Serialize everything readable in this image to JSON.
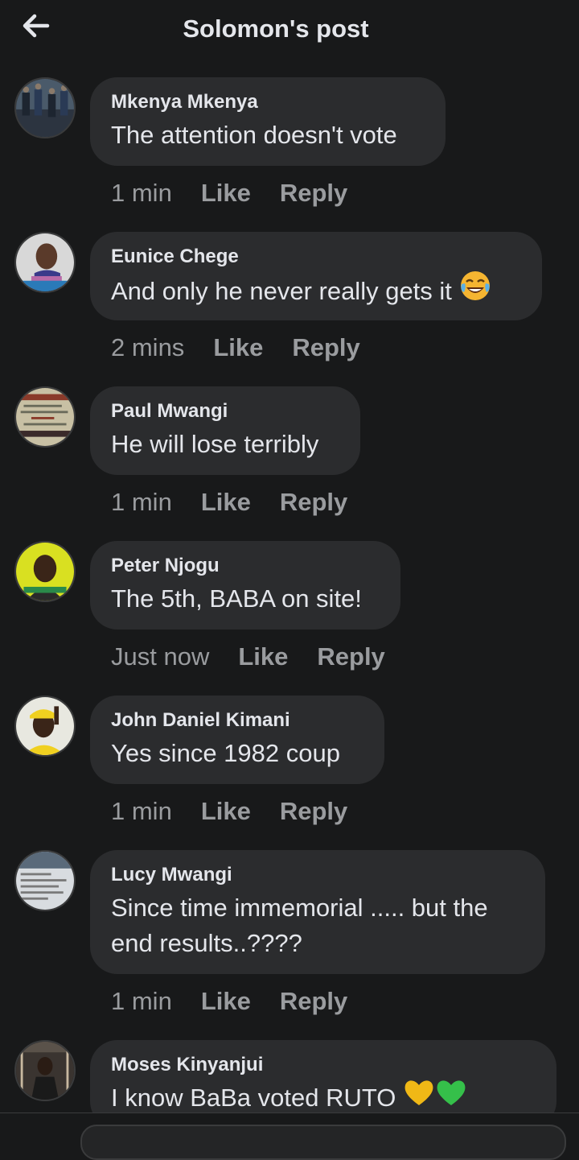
{
  "header": {
    "title": "Solomon's post",
    "back_icon": "arrow-left-icon"
  },
  "comments": [
    {
      "author": "Mkenya Mkenya",
      "text": "The attention doesn't vote",
      "time": "1 min",
      "like": "Like",
      "reply": "Reply"
    },
    {
      "author": "Eunice Chege",
      "text": "And only he never really gets it",
      "emoji": "tears-of-joy-emoji",
      "time": "2 mins",
      "like": "Like",
      "reply": "Reply"
    },
    {
      "author": "Paul Mwangi",
      "text": "He will lose terribly",
      "time": "1 min",
      "like": "Like",
      "reply": "Reply"
    },
    {
      "author": "Peter Njogu",
      "text": "The 5th, BABA on site!",
      "time": "Just now",
      "like": "Like",
      "reply": "Reply"
    },
    {
      "author": "John Daniel Kimani",
      "text": "Yes since 1982 coup",
      "time": "1 min",
      "like": "Like",
      "reply": "Reply"
    },
    {
      "author": "Lucy Mwangi",
      "text_line1": "Since time immemorial ..... but the",
      "text_line2": "end results..????",
      "time": "1 min",
      "like": "Like",
      "reply": "Reply"
    },
    {
      "author": "Moses Kinyanjui",
      "text": "I know BaBa voted RUTO",
      "emoji": [
        "yellow-heart-emoji",
        "green-heart-emoji"
      ]
    }
  ],
  "colors": {
    "background": "#18191a",
    "bubble": "#2b2c2e",
    "text": "#e4e6eb",
    "meta": "#9a9c9f"
  }
}
